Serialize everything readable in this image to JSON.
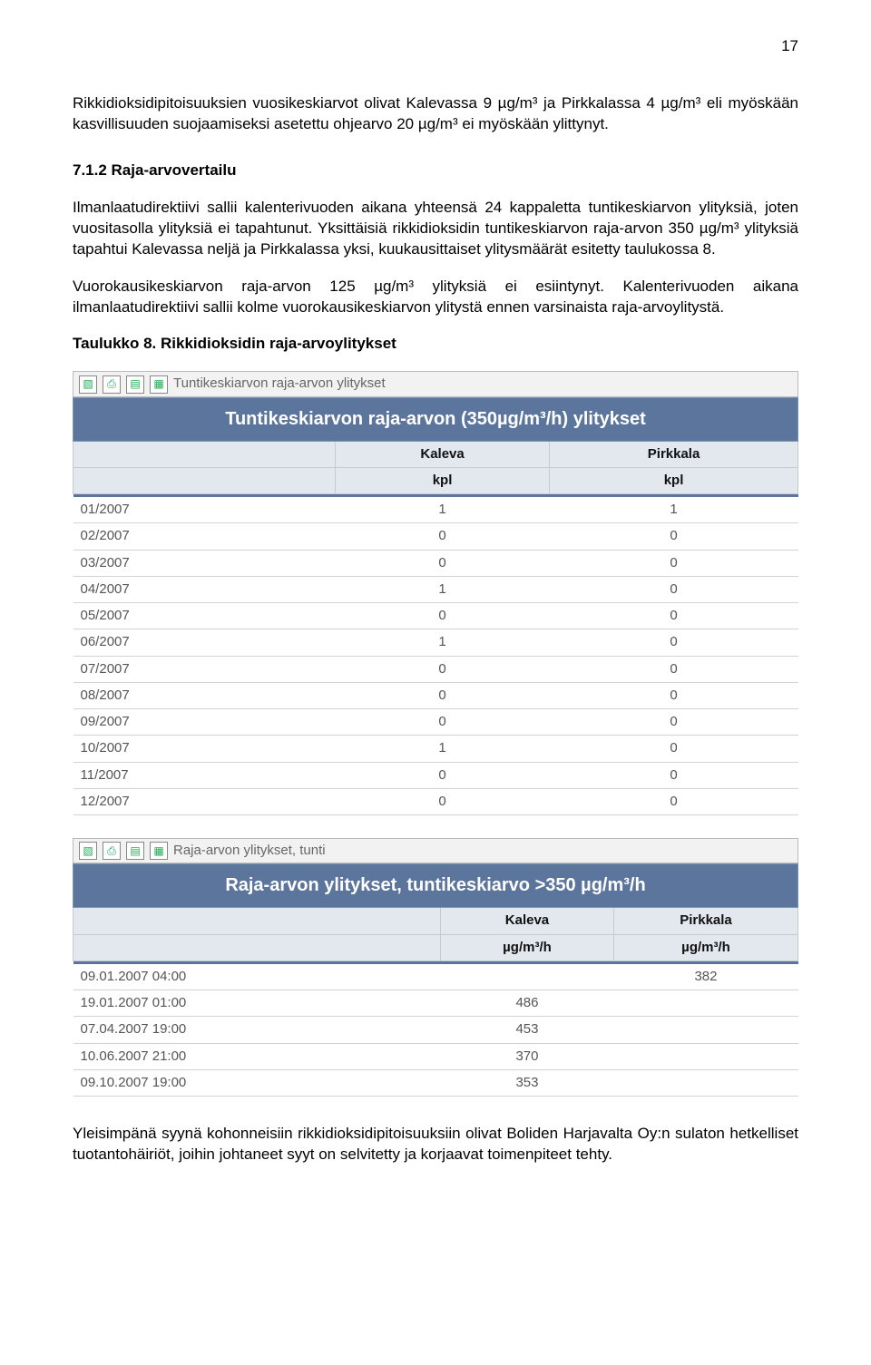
{
  "pageNumber": "17",
  "intro": "Rikkidioksidipitoisuuksien vuosikeskiarvot olivat Kalevassa 9 µg/m³ ja Pirkkalassa 4 µg/m³ eli myöskään kasvillisuuden suojaamiseksi asetettu ohjearvo 20 µg/m³ ei myöskään ylittynyt.",
  "sectionHead": "7.1.2 Raja-arvovertailu",
  "para1": "Ilmanlaatudirektiivi sallii kalenterivuoden aikana yhteensä 24 kappaletta tuntikeskiarvon ylityksiä, joten vuositasolla ylityksiä ei tapahtunut. Yksittäisiä rikkidioksidin tuntikeskiarvon raja-arvon 350 µg/m³ ylityksiä tapahtui Kalevassa neljä ja Pirkkalassa yksi, kuukausittaiset ylitysmäärät esitetty taulukossa 8.",
  "para2": "Vuorokausikeskiarvon raja-arvon 125 µg/m³ ylityksiä ei esiintynyt. Kalenterivuoden aikana ilmanlaatudirektiivi sallii kolme vuorokausikeskiarvon ylitystä ennen varsinaista raja-arvoylitystä.",
  "tblCaption": "Taulukko 8. Rikkidioksidin raja-arvoylitykset",
  "table1": {
    "toolbarTitle": "Tuntikeskiarvon raja-arvon ylitykset",
    "bigHeader": "Tuntikeskiarvon raja-arvon (350µg/m³/h) ylitykset",
    "cols": [
      "",
      "Kaleva",
      "Pirkkala"
    ],
    "units": [
      "",
      "kpl",
      "kpl"
    ],
    "rows": [
      {
        "label": "01/2007",
        "a": "1",
        "b": "1"
      },
      {
        "label": "02/2007",
        "a": "0",
        "b": "0"
      },
      {
        "label": "03/2007",
        "a": "0",
        "b": "0"
      },
      {
        "label": "04/2007",
        "a": "1",
        "b": "0"
      },
      {
        "label": "05/2007",
        "a": "0",
        "b": "0"
      },
      {
        "label": "06/2007",
        "a": "1",
        "b": "0"
      },
      {
        "label": "07/2007",
        "a": "0",
        "b": "0"
      },
      {
        "label": "08/2007",
        "a": "0",
        "b": "0"
      },
      {
        "label": "09/2007",
        "a": "0",
        "b": "0"
      },
      {
        "label": "10/2007",
        "a": "1",
        "b": "0"
      },
      {
        "label": "11/2007",
        "a": "0",
        "b": "0"
      },
      {
        "label": "12/2007",
        "a": "0",
        "b": "0"
      }
    ]
  },
  "table2": {
    "toolbarTitle": "Raja-arvon ylitykset, tunti",
    "bigHeader": "Raja-arvon ylitykset, tuntikeskiarvo >350 µg/m³/h",
    "cols": [
      "",
      "Kaleva",
      "Pirkkala"
    ],
    "units": [
      "",
      "µg/m³/h",
      "µg/m³/h"
    ],
    "rows": [
      {
        "label": "09.01.2007 04:00",
        "a": "",
        "b": "382"
      },
      {
        "label": "19.01.2007 01:00",
        "a": "486",
        "b": ""
      },
      {
        "label": "07.04.2007 19:00",
        "a": "453",
        "b": ""
      },
      {
        "label": "10.06.2007 21:00",
        "a": "370",
        "b": ""
      },
      {
        "label": "09.10.2007 19:00",
        "a": "353",
        "b": ""
      }
    ]
  },
  "closing": "Yleisimpänä syynä kohonneisiin rikkidioksidipitoisuuksiin olivat Boliden Harjavalta Oy:n sulaton hetkelliset tuotantohäiriöt, joihin johtaneet syyt on selvitetty ja korjaavat toimenpiteet tehty.",
  "icons": {
    "chart": "▧",
    "print": "⎙",
    "doc": "▤",
    "grid": "▦"
  }
}
